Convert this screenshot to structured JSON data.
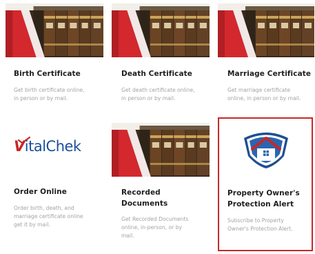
{
  "cards": [
    {
      "title": "Birth Certificate",
      "description": "Get birth certificate online,\nin person or by mail.",
      "image": "archive-shelves-photo"
    },
    {
      "title": "Death Certificate",
      "description": "Get death certificate online,\nin person or by mail.",
      "image": "archive-shelves-photo"
    },
    {
      "title": "Marriage Certificate",
      "description": "Get marriage certificate\nonline, in person or by mail.",
      "image": "archive-shelves-photo"
    },
    {
      "title": "Order Online",
      "description": "Order birth, death, and\nmarriage certificate online\nget it by mail.",
      "image": "vitalchek-logo"
    },
    {
      "title": "Recorded\nDocuments",
      "description": "Get Recorded Documents\nonline, in-person, or by\nmail.",
      "image": "archive-shelves-photo"
    },
    {
      "title": "Property Owner's\nProtection Alert",
      "description": "Subscribe to Property\nOwner's Protection Alert.",
      "image": "house-shield-logo"
    }
  ],
  "vitalchek": {
    "brand_v": "V",
    "brand_rest": "italChek"
  },
  "colors": {
    "accent_red": "#c62828",
    "brand_blue": "#1a4f9c",
    "title": "#1e1e1e",
    "description": "#a3a3a3"
  }
}
